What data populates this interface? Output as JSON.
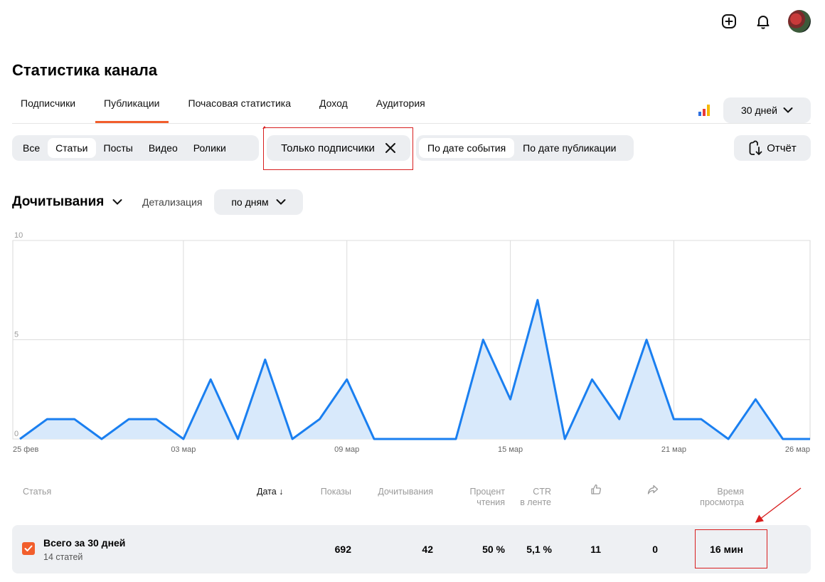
{
  "header": {
    "add_icon": "plus-square-icon",
    "bell_icon": "bell-icon",
    "avatar": "user-avatar"
  },
  "page_title": "Статистика канала",
  "tabs": [
    {
      "label": "Подписчики",
      "active": false
    },
    {
      "label": "Публикации",
      "active": true
    },
    {
      "label": "Почасовая статистика",
      "active": false
    },
    {
      "label": "Доход",
      "active": false
    },
    {
      "label": "Аудитория",
      "active": false
    }
  ],
  "period": {
    "label": "30 дней"
  },
  "content_types": [
    {
      "label": "Все",
      "selected": false
    },
    {
      "label": "Статьи",
      "selected": true
    },
    {
      "label": "Посты",
      "selected": false
    },
    {
      "label": "Видео",
      "selected": false
    },
    {
      "label": "Ролики",
      "selected": false
    }
  ],
  "filter_chip": {
    "label": "Только подписчики"
  },
  "date_mode": [
    {
      "label": "По дате события",
      "selected": true
    },
    {
      "label": "По дате публикации",
      "selected": false
    }
  ],
  "report_button": {
    "label": "Отчёт"
  },
  "metric": {
    "label": "Дочитывания"
  },
  "detail": {
    "label": "Детализация",
    "value": "по дням"
  },
  "colors": {
    "accent": "#f25e2c",
    "line": "#1a7ff0",
    "fill": "#d8e9fb",
    "annotation": "#d81e1e"
  },
  "chart_data": {
    "type": "area",
    "x": [
      "25 фев",
      "26 фев",
      "27 фев",
      "28 фев",
      "01 мар",
      "02 мар",
      "03 мар",
      "04 мар",
      "05 мар",
      "06 мар",
      "07 мар",
      "08 мар",
      "09 мар",
      "10 мар",
      "11 мар",
      "12 мар",
      "13 мар",
      "14 мар",
      "15 мар",
      "16 мар",
      "17 мар",
      "18 мар",
      "19 мар",
      "20 мар",
      "21 мар",
      "22 мар",
      "23 мар",
      "24 мар",
      "25 мар",
      "26 мар"
    ],
    "y": [
      0,
      1,
      1,
      0,
      1,
      1,
      0,
      3,
      0,
      4,
      0,
      1,
      3,
      0,
      0,
      0,
      0,
      5,
      2,
      7,
      0,
      3,
      1,
      5,
      1,
      1,
      0,
      2,
      0,
      0
    ],
    "x_ticks": [
      "25 фев",
      "03 мар",
      "09 мар",
      "15 мар",
      "21 мар",
      "26 мар"
    ],
    "y_ticks": [
      "10",
      "5",
      "0"
    ],
    "ylim": [
      0,
      10
    ],
    "grid": true
  },
  "table": {
    "headers": {
      "article": "Статья",
      "date": "Дата",
      "shows": "Показы",
      "reads": "Дочитывания",
      "percent_1": "Процент",
      "percent_2": "чтения",
      "ctr_1": "CTR",
      "ctr_2": "в ленте",
      "time_1": "Время",
      "time_2": "просмотра"
    },
    "like_icon": "thumbs-up-icon",
    "share_icon": "share-icon",
    "summary": {
      "title": "Всего за 30 дней",
      "subtitle": "14 статей",
      "shows": "692",
      "reads": "42",
      "percent": "50 %",
      "ctr": "5,1 %",
      "likes": "11",
      "shares": "0",
      "time": "16 мин"
    }
  }
}
